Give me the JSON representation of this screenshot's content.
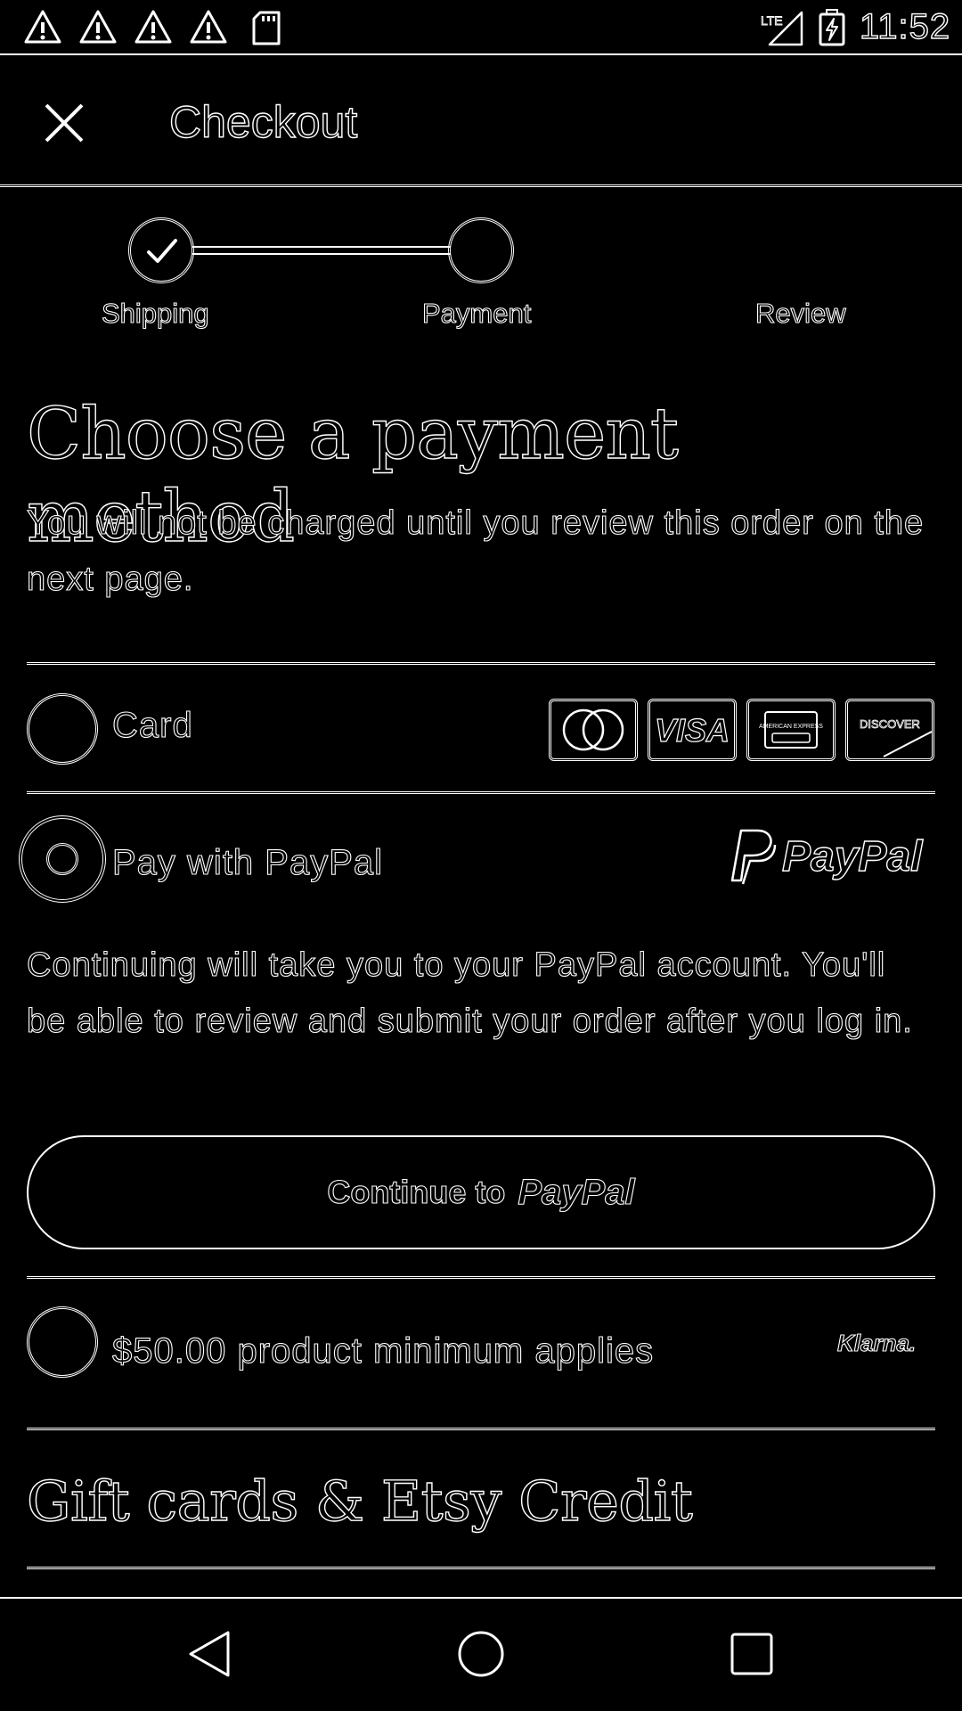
{
  "status_bar": {
    "time": "11:52",
    "icons": [
      "warning-icon",
      "warning-icon",
      "warning-icon",
      "warning-icon",
      "sd-card-icon",
      "lte-signal-icon",
      "battery-charging-icon"
    ],
    "network_label": "LTE"
  },
  "toolbar": {
    "title": "Checkout",
    "close_icon": "close-icon"
  },
  "stepper": {
    "steps": [
      {
        "label": "Shipping",
        "state": "complete"
      },
      {
        "label": "Payment",
        "state": "current"
      },
      {
        "label": "Review",
        "state": "upcoming"
      }
    ]
  },
  "payment": {
    "heading": "Choose a payment method",
    "subtext": "You will not be charged until you review this order on the next page.",
    "options": {
      "card": {
        "label": "Card",
        "selected": false,
        "logos": [
          "MasterCard",
          "VISA",
          "AMERICAN EXPRESS",
          "DISCOVER"
        ]
      },
      "paypal": {
        "label": "Pay with PayPal",
        "selected": true,
        "brand": "PayPal",
        "description": "Continuing will take you to your PayPal account. You'll be able to review and submit your order after you log in.",
        "button_label": "Continue to",
        "button_brand": "PayPal"
      },
      "klarna": {
        "label": "$50.00 product minimum applies",
        "selected": false,
        "brand": "Klarna."
      }
    }
  },
  "gift_cards": {
    "heading": "Gift cards & Etsy Credit"
  },
  "nav_bar": {
    "buttons": [
      "back-icon",
      "home-icon",
      "recents-icon"
    ]
  }
}
